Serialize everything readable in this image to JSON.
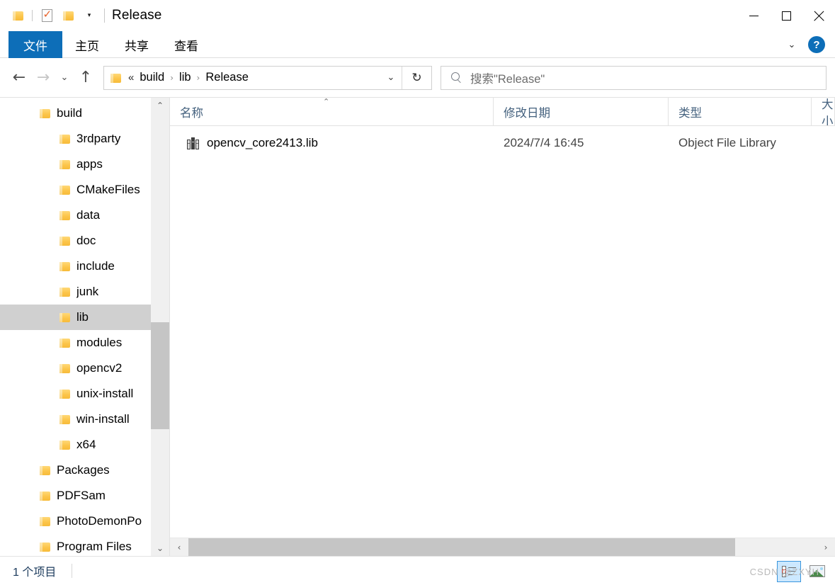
{
  "titlebar": {
    "title": "Release",
    "quick_access": [
      {
        "name": "folder-icon",
        "label": ""
      },
      {
        "name": "properties-icon",
        "label": ""
      },
      {
        "name": "new-folder-icon",
        "label": ""
      },
      {
        "name": "chevron-down-icon",
        "label": "▾"
      }
    ],
    "window_controls": {
      "minimize": "",
      "maximize": "",
      "close": ""
    }
  },
  "ribbon": {
    "tabs": [
      {
        "label": "文件",
        "active": true
      },
      {
        "label": "主页",
        "active": false
      },
      {
        "label": "共享",
        "active": false
      },
      {
        "label": "查看",
        "active": false
      }
    ],
    "expand_label": "⌄",
    "help_label": "?",
    "accent_color": "#0d6eb8"
  },
  "navbar": {
    "back_label": "←",
    "forward_label": "→",
    "recent_label": "⌄",
    "up_label": "↑",
    "address": {
      "ellipsis": "«",
      "crumbs": [
        "build",
        "lib",
        "Release"
      ],
      "separator": "›",
      "dropdown_label": "⌄",
      "refresh_label": "↻"
    },
    "search": {
      "placeholder": "搜索\"Release\"",
      "icon": "search-icon"
    }
  },
  "sidebar": {
    "items": [
      {
        "label": "build",
        "indent": 56,
        "selected": false
      },
      {
        "label": "3rdparty",
        "indent": 84,
        "selected": false
      },
      {
        "label": "apps",
        "indent": 84,
        "selected": false
      },
      {
        "label": "CMakeFiles",
        "indent": 84,
        "selected": false
      },
      {
        "label": "data",
        "indent": 84,
        "selected": false
      },
      {
        "label": "doc",
        "indent": 84,
        "selected": false
      },
      {
        "label": "include",
        "indent": 84,
        "selected": false
      },
      {
        "label": "junk",
        "indent": 84,
        "selected": false
      },
      {
        "label": "lib",
        "indent": 84,
        "selected": true
      },
      {
        "label": "modules",
        "indent": 84,
        "selected": false
      },
      {
        "label": "opencv2",
        "indent": 84,
        "selected": false
      },
      {
        "label": "unix-install",
        "indent": 84,
        "selected": false
      },
      {
        "label": "win-install",
        "indent": 84,
        "selected": false
      },
      {
        "label": "x64",
        "indent": 84,
        "selected": false
      },
      {
        "label": "Packages",
        "indent": 56,
        "selected": false
      },
      {
        "label": "PDFSam",
        "indent": 56,
        "selected": false
      },
      {
        "label": "PhotoDemonPo",
        "indent": 56,
        "selected": false
      },
      {
        "label": "Program Files",
        "indent": 56,
        "selected": false
      }
    ],
    "scroll_up_label": "⌃",
    "scroll_down_label": "⌄"
  },
  "filelist": {
    "columns": [
      {
        "label": "名称",
        "sorted": "asc"
      },
      {
        "label": "修改日期",
        "sorted": ""
      },
      {
        "label": "类型",
        "sorted": ""
      },
      {
        "label": "大小",
        "sorted": ""
      }
    ],
    "sort_indicator": "⌃",
    "rows": [
      {
        "icon": "object-file-library-icon",
        "name": "opencv_core2413.lib",
        "date": "2024/7/4 16:45",
        "type": "Object File Library",
        "size": ""
      }
    ],
    "hscroll": {
      "left_label": "‹",
      "right_label": "›"
    }
  },
  "statusbar": {
    "item_count": "1 个项目",
    "view_buttons": [
      {
        "name": "details-view-button",
        "active": true
      },
      {
        "name": "large-icons-view-button",
        "active": false
      }
    ],
    "watermark": "CSDN @ZXYH"
  }
}
